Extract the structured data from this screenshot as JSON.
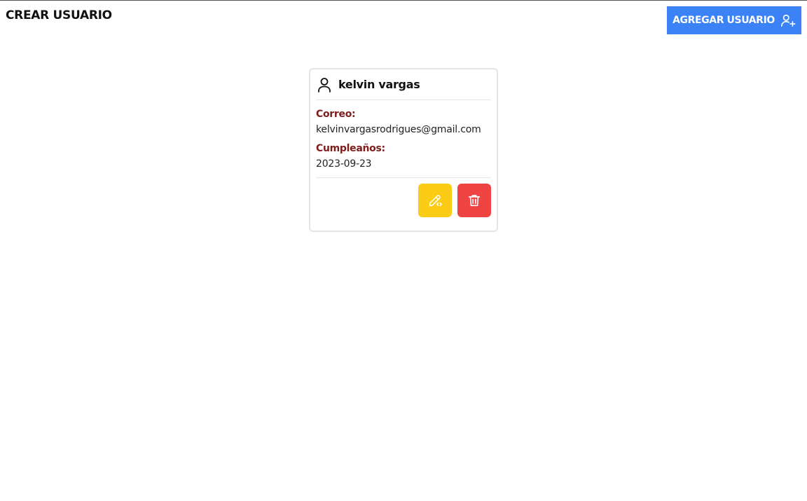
{
  "header": {
    "title": "CREAR USUARIO",
    "add_button_label": "AGREGAR USUARIO",
    "add_button_icon": "user-plus-icon",
    "accent_color": "#3b82f6"
  },
  "users": [
    {
      "name": "kelvin vargas",
      "icon": "user-icon",
      "email_label": "Correo:",
      "email": "kelvinvargasrodrigues@gmail.com",
      "birthday_label": "Cumpleaños:",
      "birthday": "2023-09-23",
      "edit_icon": "pencil-edit-icon",
      "edit_color": "#facc15",
      "delete_icon": "trash-icon",
      "delete_color": "#ef4444"
    }
  ]
}
